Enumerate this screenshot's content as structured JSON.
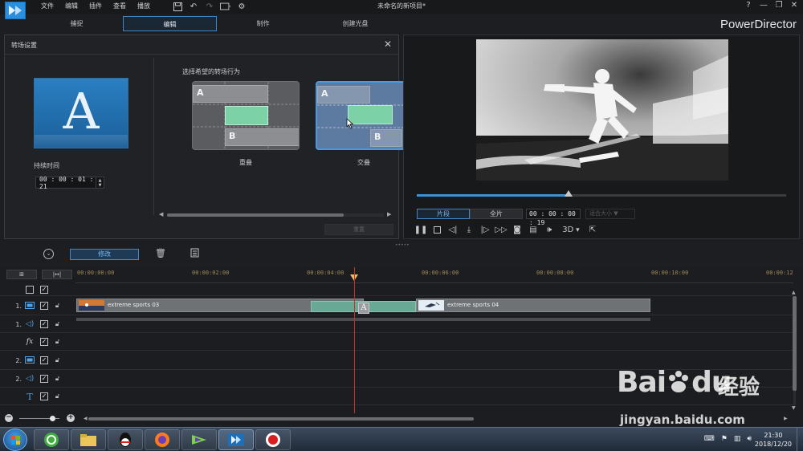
{
  "window": {
    "title": "未命名的新项目*",
    "menu": [
      "文件",
      "编辑",
      "插件",
      "查看",
      "播放"
    ],
    "controls": [
      "?",
      "—",
      "❐",
      "✕"
    ]
  },
  "modes": [
    {
      "label": "捕捉",
      "active": false
    },
    {
      "label": "编辑",
      "active": true
    },
    {
      "label": "制作",
      "active": false
    },
    {
      "label": "创建光盘",
      "active": false
    }
  ],
  "brand": "PowerDirector",
  "transition_panel": {
    "title": "转场设置",
    "duration_label": "持续时间",
    "duration_value": "00 : 00 : 01 : 21",
    "behavior_label": "选择希望的转场行为",
    "options": [
      {
        "label": "重叠",
        "selected": false
      },
      {
        "label": "交叠",
        "selected": true
      }
    ],
    "block_a": "A",
    "block_b": "B",
    "reset_label": "重置"
  },
  "preview": {
    "tabs": [
      {
        "label": "片段",
        "active": true
      },
      {
        "label": "全片",
        "active": false
      }
    ],
    "timecode": "00 : 00 : 00 : 19",
    "fit_label": "适合大小",
    "progress": 0.41,
    "three_d_label": "3D"
  },
  "toolbar": {
    "modify_label": "修改"
  },
  "timeline": {
    "ruler_ticks": [
      "00:00:00:00",
      "00:00:02:00",
      "00:00:04:00",
      "00:00:06:00",
      "00:00:08:00",
      "00:00:10:00",
      "00:00:12"
    ],
    "tracks": [
      {
        "number": "1.",
        "kind": "video"
      },
      {
        "number": "1.",
        "kind": "audio"
      },
      {
        "number": "",
        "kind": "fx"
      },
      {
        "number": "2.",
        "kind": "video"
      },
      {
        "number": "2.",
        "kind": "audio"
      },
      {
        "number": "",
        "kind": "title"
      }
    ],
    "clips": [
      {
        "name": "extreme sports 03"
      },
      {
        "name": "extreme sports 04"
      }
    ],
    "transition_icon": "A"
  },
  "taskbar": {
    "time": "21:30",
    "date": "2018/12/20"
  },
  "watermark": {
    "brand": "Bai",
    "brand_tail": "du",
    "cn": "经验",
    "url": "jingyan.baidu.com"
  },
  "colors": {
    "accent": "#3c87c7",
    "transition_block": "#7cd1a6",
    "playhead": "#c8302d"
  }
}
